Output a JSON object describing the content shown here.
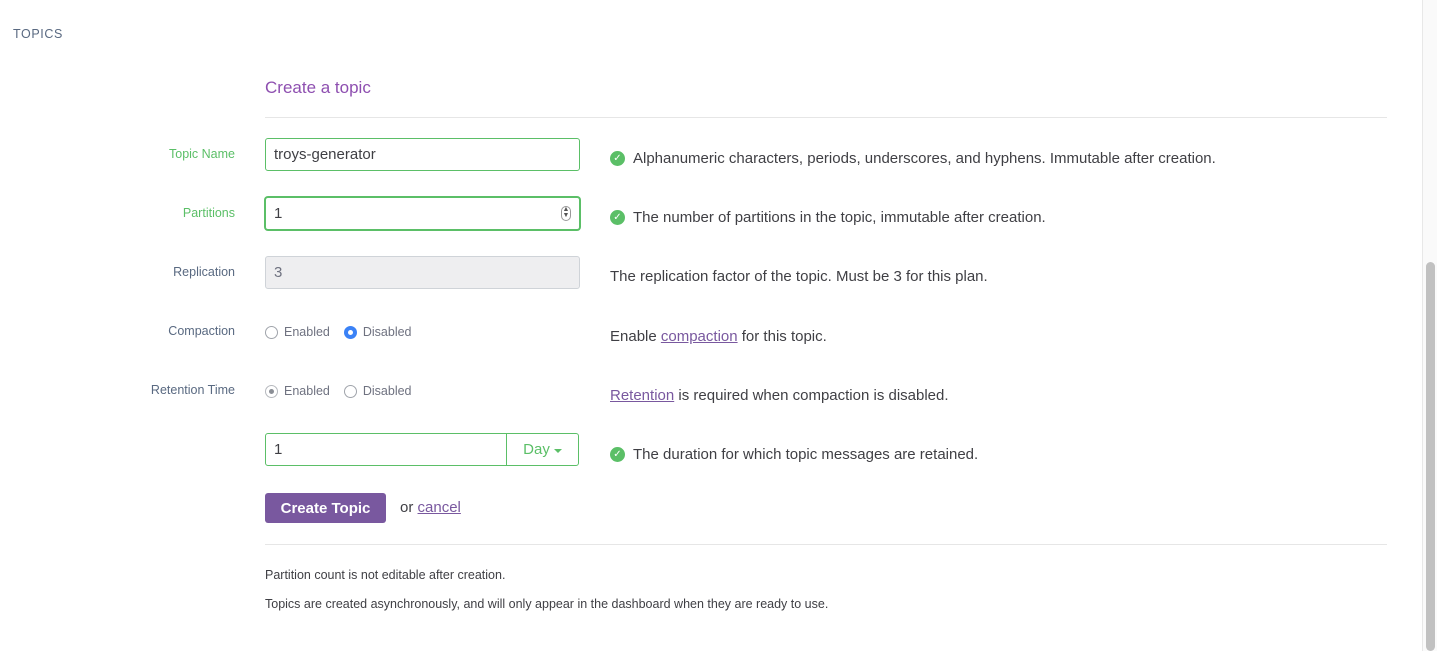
{
  "section_label": "TOPICS",
  "form": {
    "title": "Create a topic",
    "topic_name": {
      "label": "Topic Name",
      "value": "troys-generator",
      "help": "Alphanumeric characters, periods, underscores, and hyphens. Immutable after creation."
    },
    "partitions": {
      "label": "Partitions",
      "value": "1",
      "help": "The number of partitions in the topic, immutable after creation."
    },
    "replication": {
      "label": "Replication",
      "value": "3",
      "help": "The replication factor of the topic. Must be 3 for this plan."
    },
    "compaction": {
      "label": "Compaction",
      "options": [
        "Enabled",
        "Disabled"
      ],
      "selected": "Disabled",
      "help_prefix": "Enable ",
      "help_link": "compaction",
      "help_suffix": " for this topic."
    },
    "retention": {
      "label": "Retention Time",
      "options": [
        "Enabled",
        "Disabled"
      ],
      "selected": "Enabled",
      "help_link": "Retention",
      "help_suffix": " is required when compaction is disabled.",
      "value": "1",
      "unit": "Day",
      "duration_help": "The duration for which topic messages are retained."
    },
    "submit_label": "Create Topic",
    "or_text": "or ",
    "cancel_label": "cancel"
  },
  "notes": [
    "Partition count is not editable after creation.",
    "Topics are created asynchronously, and will only appear in the dashboard when they are ready to use."
  ],
  "colors": {
    "accent": "#79589f",
    "title": "#8e4fb0",
    "success": "#5bbf67",
    "label": "#596981"
  }
}
